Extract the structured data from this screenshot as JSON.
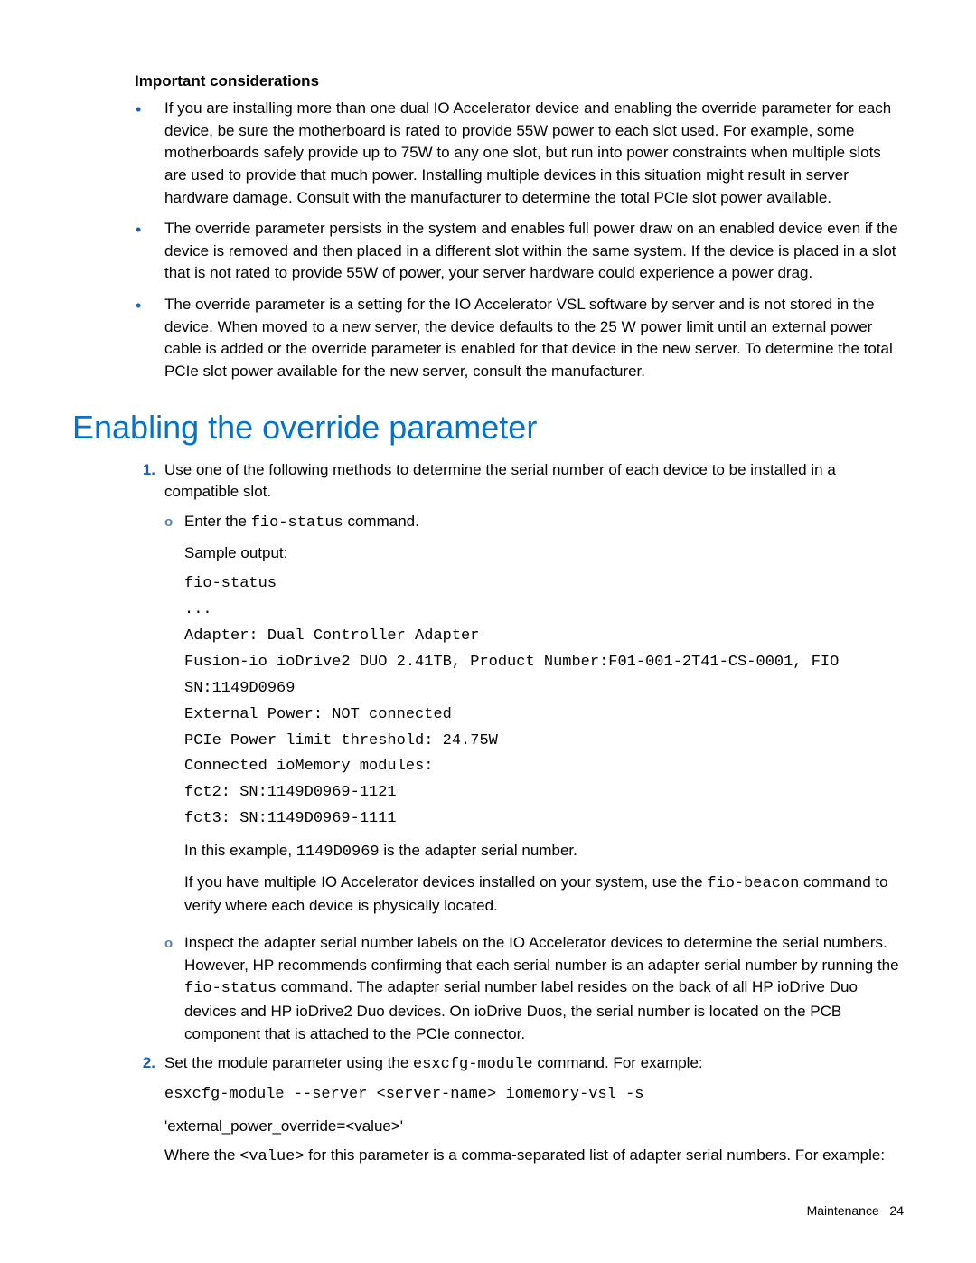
{
  "section_heading": "Important considerations",
  "bullets": [
    "If you are installing more than one dual IO Accelerator device and enabling the override parameter for each device, be sure the motherboard is rated to provide 55W power to each slot used. For example, some motherboards safely provide up to 75W to any one slot, but run into power constraints when multiple slots are used to provide that much power. Installing multiple devices in this situation might result in server hardware damage. Consult with the manufacturer to determine the total PCIe slot power available.",
    "The override parameter persists in the system and enables full power draw on an enabled device even if the device is removed and then placed in a different slot within the same system. If the device is placed in a slot that is not rated to provide 55W of power, your server hardware could experience a power drag.",
    "The override parameter is a setting for the IO Accelerator VSL software by server and is not stored in the device. When moved to a new server, the device defaults to the 25 W power limit until an external power cable is added or the override parameter is enabled for that device in the new server. To determine the total PCIe slot power available for the new server, consult the manufacturer."
  ],
  "h2": "Enabling the override parameter",
  "steps": {
    "step1": {
      "num": "1.",
      "text": "Use one of the following methods to determine the serial number of each device to be installed in a compatible slot.",
      "sub_a": {
        "marker": "o",
        "lead_pre": "Enter the ",
        "lead_code": "fio-status",
        "lead_post": " command.",
        "sample_label": "Sample output:",
        "code": "fio-status\n...\nAdapter: Dual Controller Adapter\nFusion-io ioDrive2 DUO 2.41TB, Product Number:F01-001-2T41-CS-0001, FIO\nSN:1149D0969\nExternal Power: NOT connected\nPCIe Power limit threshold: 24.75W\nConnected ioMemory modules:\nfct2: SN:1149D0969-1121\nfct3: SN:1149D0969-1111",
        "after1_pre": "In this example, ",
        "after1_code": "1149D0969",
        "after1_post": " is the adapter serial number.",
        "after2_pre": "If you have multiple IO Accelerator devices installed on your system, use the ",
        "after2_code": "fio-beacon",
        "after2_post": " command to verify where each device is physically located."
      },
      "sub_b": {
        "marker": "o",
        "text_pre": "Inspect the adapter serial number labels on the IO Accelerator devices to determine the serial numbers. However, HP recommends confirming that each serial number is an adapter serial number by running the ",
        "text_code": "fio-status",
        "text_post": " command. The adapter serial number label resides on the back of all HP ioDrive Duo devices and HP ioDrive2 Duo devices. On ioDrive Duos, the serial number is located on the PCB component that is attached to the PCIe connector."
      }
    },
    "step2": {
      "num": "2.",
      "lead_pre": "Set the module parameter using the ",
      "lead_code": "esxcfg-module",
      "lead_post": " command. For example:",
      "code": "esxcfg-module --server <server-name> iomemory-vsl -s",
      "line2": "'external_power_override=<value>'",
      "after_pre": "Where the ",
      "after_code": "<value>",
      "after_post": " for this parameter is a comma-separated list of adapter serial numbers. For example:"
    }
  },
  "footer": {
    "section": "Maintenance",
    "page": "24"
  }
}
